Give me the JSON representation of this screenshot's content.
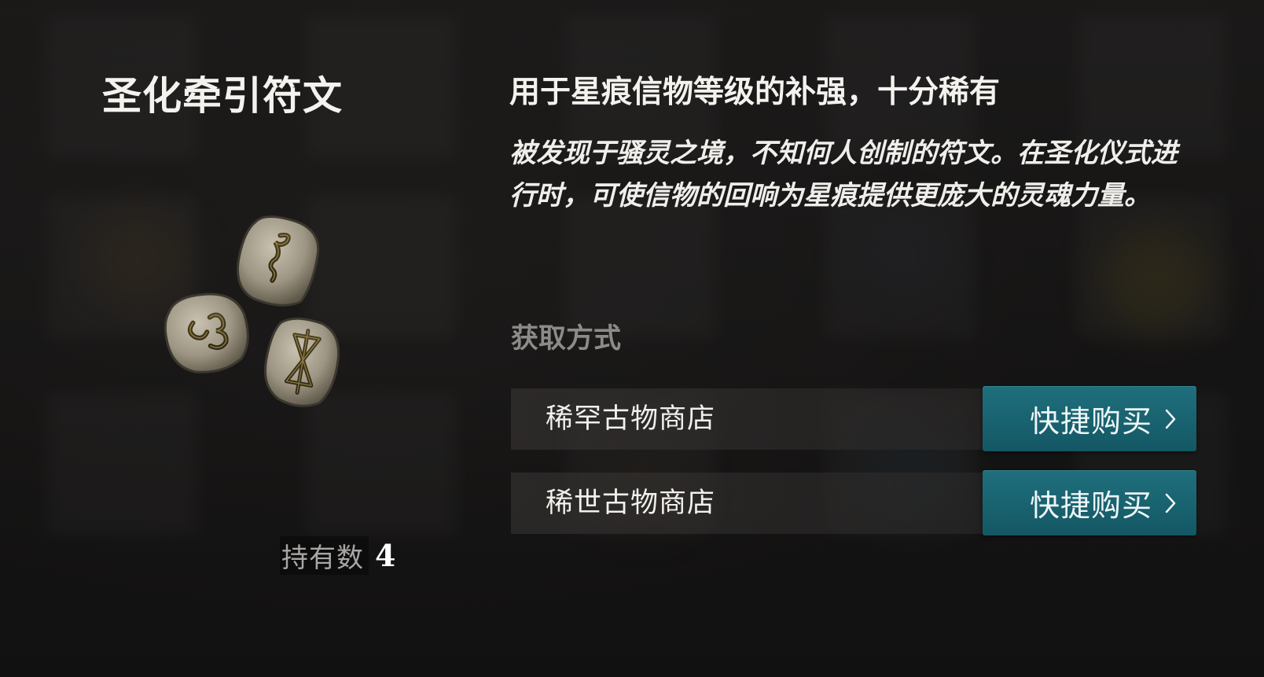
{
  "item": {
    "title": "圣化牵引符文",
    "owned_label": "持有数",
    "owned_count": "4",
    "icon": "rune-stones-icon"
  },
  "details": {
    "summary": "用于星痕信物等级的补强，十分稀有",
    "description": "被发现于骚灵之境，不知何人创制的符文。在圣化仪式进行时，可使信物的回响为星痕提供更庞大的灵魂力量。"
  },
  "acquire": {
    "heading": "获取方式",
    "sources": [
      {
        "name": "稀罕古物商店",
        "button_label": "快捷购买"
      },
      {
        "name": "稀世古物商店",
        "button_label": "快捷购买"
      }
    ]
  },
  "colors": {
    "button": "#1a6573",
    "heading_muted": "#8d8a87",
    "text": "#f2f0ec"
  }
}
